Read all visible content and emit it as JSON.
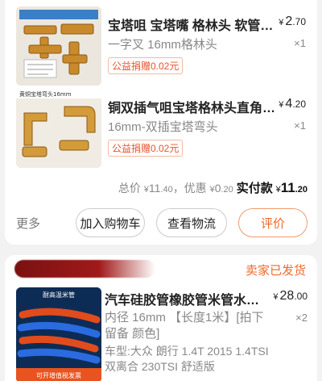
{
  "order1": {
    "items": [
      {
        "title": "宝塔咀 宝塔嘴 格林头 软管接头 铜",
        "price_int": "2",
        "price_dec": ".70",
        "currency": "¥",
        "spec": "一字叉 16mm格林头",
        "qty": "×1",
        "badge": "公益捐赠0.02元"
      },
      {
        "title": "铜双插气咀宝塔格林头直角弯头",
        "price_int": "4",
        "price_dec": ".20",
        "currency": "¥",
        "spec": "16mm-双插宝塔弯头",
        "qty": "×1",
        "badge": "公益捐赠0.02元"
      }
    ],
    "thumb2_caption": "黄铜宝塔弯头16mm",
    "summary": {
      "total_label": "总价",
      "total_cur": "¥",
      "total_int": "11",
      "total_dec": ".40",
      "discount_label": "，优惠",
      "discount_cur": "¥",
      "discount_int": "0",
      "discount_dec": ".20",
      "paid_label": "实付款",
      "paid_cur": "¥",
      "paid_int": "11",
      "paid_dec": ".20"
    },
    "actions": {
      "more": "更多",
      "add_cart": "加入购物车",
      "logistics": "查看物流",
      "rate": "评价"
    }
  },
  "order2": {
    "status": "卖家已发货",
    "thumb_top_text": "耐高温米管",
    "thumb_bottom_text": "可开增值税发票",
    "title": "汽车硅胶管橡胶管米管水管耐高温",
    "price_cur": "¥",
    "price_int": "28",
    "price_dec": ".00",
    "spec": "内径 16mm 【长度1米】[拍下 留备 颜色]",
    "qty": "×2",
    "car": "车型:大众 朗行 1.4T 2015 1.4TSI 双离合 230TSI 舒适版"
  },
  "colors": {
    "accent": "#ee6a2c",
    "badge_border": "#f6b8a0",
    "muted": "#888888"
  }
}
